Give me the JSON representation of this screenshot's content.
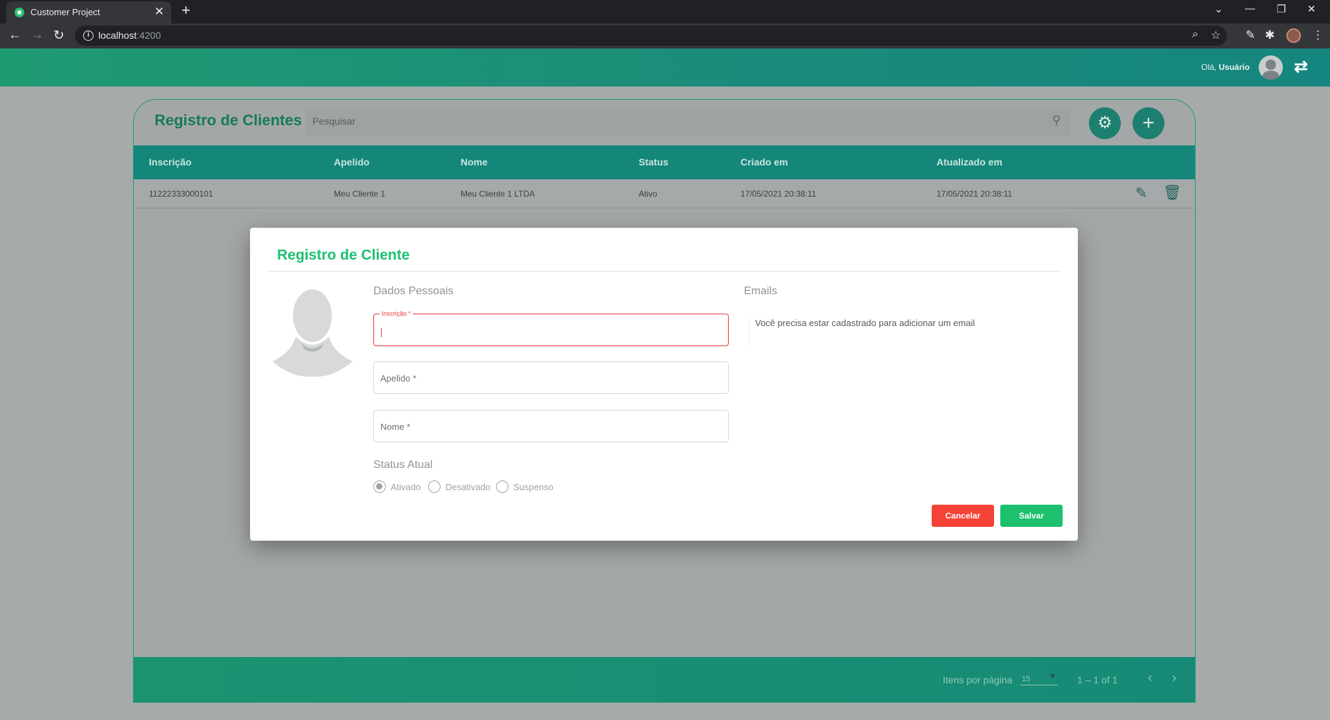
{
  "browser": {
    "tab_title": "Customer Project",
    "url_host": "localhost",
    "url_port": ":4200"
  },
  "header": {
    "greeting_prefix": "Olá,",
    "user_name": "Usuário"
  },
  "list": {
    "title": "Registro de Clientes",
    "search_placeholder": "Pesquisar",
    "columns": [
      "Inscrição",
      "Apelido",
      "Nome",
      "Status",
      "Criado em",
      "Atualizado em"
    ],
    "rows": [
      {
        "inscricao": "11222333000101",
        "apelido": "Meu Cliente 1",
        "nome": "Meu Cliente 1 LTDA",
        "status": "Ativo",
        "criado_em": "17/05/2021 20:38:11",
        "atualizado_em": "17/05/2021 20:38:11"
      }
    ],
    "paginator": {
      "items_label": "Itens por página",
      "page_size": "15",
      "range": "1 – 1 of 1"
    }
  },
  "dialog": {
    "title": "Registro de Cliente",
    "personal_section": "Dados Pessoais",
    "emails_section": "Emails",
    "fields": {
      "inscricao_label": "Inscrição *",
      "inscricao_value": "",
      "apelido_placeholder": "Apelido *",
      "nome_placeholder": "Nome *"
    },
    "status_title": "Status Atual",
    "status_options": [
      "Ativado",
      "Desativado",
      "Suspenso"
    ],
    "status_selected": "Ativado",
    "email_message": "Você precisa estar cadastrado para adicionar um email",
    "cancel_label": "Cancelar",
    "save_label": "Salvar"
  },
  "colors": {
    "primary": "#1f9b73",
    "accent_green": "#1cc06d",
    "danger": "#f44336",
    "title_green": "#1cbf72"
  },
  "icons": [
    "back-icon",
    "forward-icon",
    "reload-icon",
    "info-icon",
    "zoom-icon",
    "star-icon",
    "extensions-icon",
    "menu-icon",
    "settings-icon",
    "add-icon",
    "search-icon",
    "edit-icon",
    "delete-icon",
    "swap-icon",
    "avatar-icon"
  ]
}
